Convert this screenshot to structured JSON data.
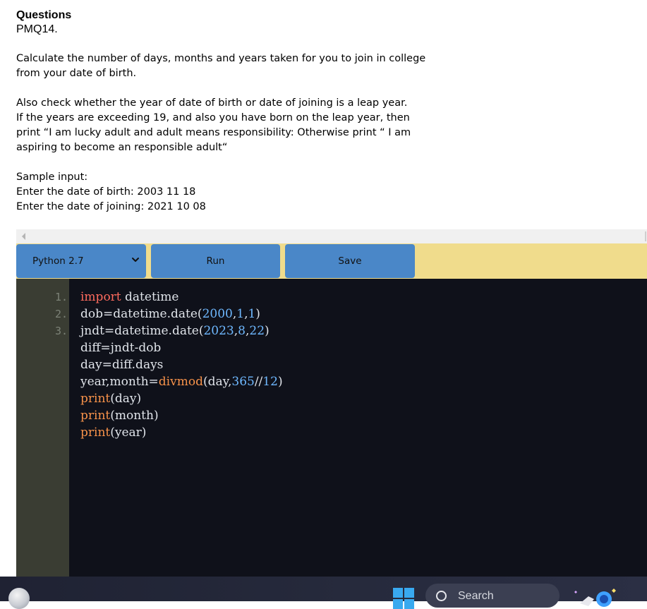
{
  "question": {
    "heading": "Questions",
    "code": "PMQ14.",
    "paragraph1": [
      "Calculate the number of days, months and years taken for you to join in college",
      "from your date of birth."
    ],
    "paragraph2": [
      "Also check whether the year of date of birth or date of joining is a leap year.",
      "If the years are exceeding 19, and also you have born on the leap year, then",
      "print “I am lucky adult and adult means responsibility: Otherwise print “ I am",
      "aspiring to become an responsible adult“"
    ],
    "sample": [
      "Sample input:",
      "Enter the date of birth: 2003 11 18",
      "Enter the date of joining: 2021 10 08"
    ]
  },
  "toolbar": {
    "language": "Python 2.7",
    "run_label": "Run",
    "save_label": "Save"
  },
  "editor": {
    "line_numbers": [
      "1.",
      "2.",
      "3."
    ],
    "lines": [
      [
        {
          "t": "import",
          "c": "kw"
        },
        {
          "t": " datetime",
          "c": ""
        }
      ],
      [
        {
          "t": "dob=datetime.date(",
          "c": ""
        },
        {
          "t": "2000",
          "c": "num"
        },
        {
          "t": ",",
          "c": ""
        },
        {
          "t": "1",
          "c": "num"
        },
        {
          "t": ",",
          "c": ""
        },
        {
          "t": "1",
          "c": "num"
        },
        {
          "t": ")",
          "c": ""
        }
      ],
      [
        {
          "t": "jndt=datetime.date(",
          "c": ""
        },
        {
          "t": "2023",
          "c": "num"
        },
        {
          "t": ",",
          "c": ""
        },
        {
          "t": "8",
          "c": "num"
        },
        {
          "t": ",",
          "c": ""
        },
        {
          "t": "22",
          "c": "num"
        },
        {
          "t": ")",
          "c": ""
        }
      ],
      [
        {
          "t": "diff=jndt-dob",
          "c": ""
        }
      ],
      [
        {
          "t": "day=diff.days",
          "c": ""
        }
      ],
      [
        {
          "t": "year,month=",
          "c": ""
        },
        {
          "t": "divmod",
          "c": "fn"
        },
        {
          "t": "(day,",
          "c": ""
        },
        {
          "t": "365",
          "c": "num"
        },
        {
          "t": "//",
          "c": ""
        },
        {
          "t": "12",
          "c": "num"
        },
        {
          "t": ")",
          "c": ""
        }
      ],
      [
        {
          "t": "print",
          "c": "fn"
        },
        {
          "t": "(day)",
          "c": ""
        }
      ],
      [
        {
          "t": "print",
          "c": "fn"
        },
        {
          "t": "(month)",
          "c": ""
        }
      ],
      [
        {
          "t": "print",
          "c": "fn"
        },
        {
          "t": "(year)",
          "c": ""
        }
      ]
    ]
  },
  "taskbar": {
    "search_label": "Search",
    "icons": [
      "profile-icon",
      "windows-start-icon",
      "search-icon",
      "copilot-icon"
    ]
  },
  "colors": {
    "toolbar_bg": "#f0dc8c",
    "button_bg": "#4a87c8",
    "editor_bg": "#0f111a",
    "gutter_bg": "#3a3d33",
    "keyword": "#ff6b5e",
    "number": "#6eb8ff",
    "function": "#f7924a"
  }
}
